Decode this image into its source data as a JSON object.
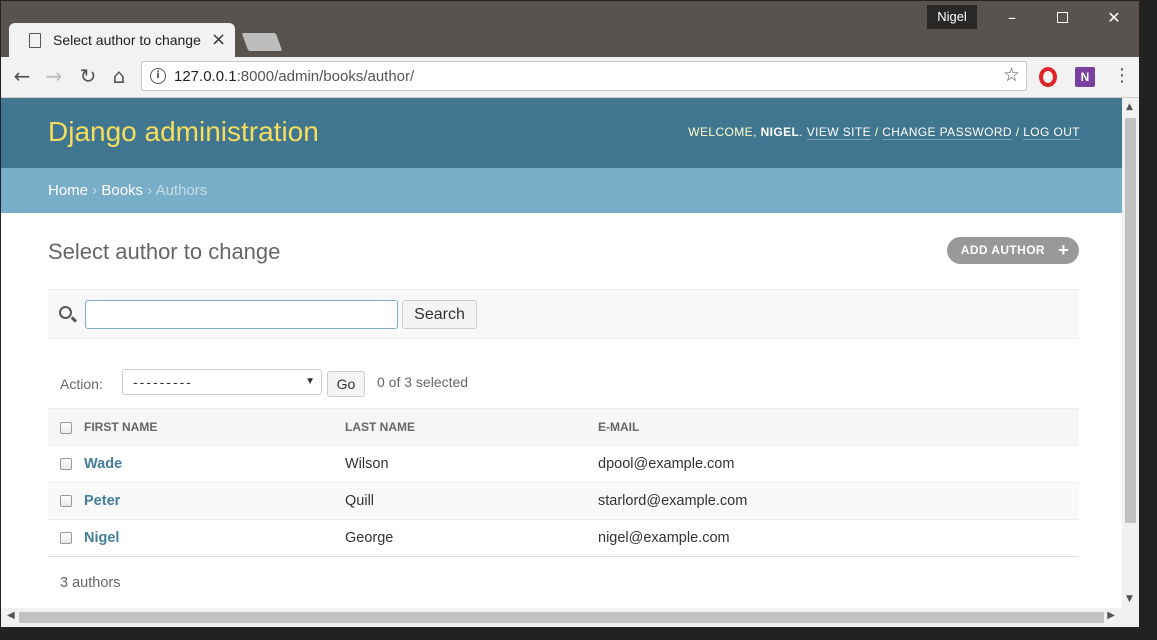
{
  "browser": {
    "tab_title": "Select author to change | Django site admin",
    "tab_close": "×",
    "profile_name": "Nigel",
    "url_host": "127.0.0.1",
    "url_path": ":8000/admin/books/author/",
    "icons": {
      "back": "back-arrow-icon",
      "forward": "forward-arrow-icon",
      "reload": "reload-icon",
      "home": "home-icon",
      "info": "info-icon",
      "bookmark": "star-icon",
      "opera": "opera-extension-icon",
      "onenote": "onenote-extension-icon",
      "menu": "kebab-menu-icon"
    }
  },
  "header": {
    "branding": "Django administration",
    "welcome_prefix": "WELCOME, ",
    "username": "NIGEL",
    "view_site": "VIEW SITE",
    "change_password": "CHANGE PASSWORD",
    "log_out": "LOG OUT",
    "separator": " / "
  },
  "breadcrumbs": {
    "home": "Home",
    "books": "Books",
    "current": "Authors",
    "separator": " › "
  },
  "content": {
    "title": "Select author to change",
    "add_button": "ADD AUTHOR",
    "add_icon": "+"
  },
  "search": {
    "value": "",
    "button_label": "Search"
  },
  "actions": {
    "label": "Action:",
    "selected_option": "---------",
    "go_label": "Go",
    "selected_count": "0 of 3 selected"
  },
  "table": {
    "columns": [
      "FIRST NAME",
      "LAST NAME",
      "E-MAIL"
    ],
    "rows": [
      {
        "first_name": "Wade",
        "last_name": "Wilson",
        "email": "dpool@example.com"
      },
      {
        "first_name": "Peter",
        "last_name": "Quill",
        "email": "starlord@example.com"
      },
      {
        "first_name": "Nigel",
        "last_name": "George",
        "email": "nigel@example.com"
      }
    ]
  },
  "paginator": {
    "text": "3 authors"
  },
  "colors": {
    "header_bg": "#417690",
    "branding": "#f5dd5d",
    "breadcrumbs_bg": "#79aec8",
    "link": "#447e9b"
  }
}
